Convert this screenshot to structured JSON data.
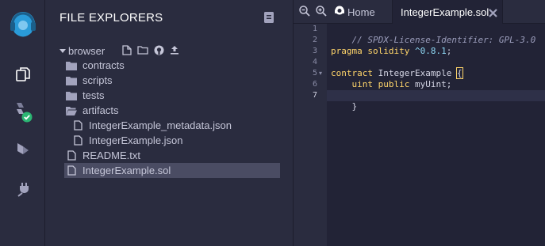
{
  "panel": {
    "title": "FILE EXPLORERS",
    "root": "browser",
    "items": [
      {
        "label": "contracts",
        "type": "folder"
      },
      {
        "label": "scripts",
        "type": "folder"
      },
      {
        "label": "tests",
        "type": "folder"
      },
      {
        "label": "artifacts",
        "type": "folder-open"
      },
      {
        "label": "IntegerExample_metadata.json",
        "type": "file"
      },
      {
        "label": "IntegerExample.json",
        "type": "file"
      },
      {
        "label": "README.txt",
        "type": "file"
      },
      {
        "label": "IntegerExample.sol",
        "type": "file",
        "selected": true
      }
    ]
  },
  "tabs": {
    "home": "Home",
    "active": "IntegerExample.sol"
  },
  "editor": {
    "line_numbers": [
      "1",
      "2",
      "3",
      "4",
      "5",
      "6",
      "7"
    ],
    "active_line": "7",
    "lines": {
      "l1": "// SPDX-License-Identifier: GPL-3.0",
      "l3_kw": "pragma solidity",
      "l3_ver": " ^0.8.1",
      "l3_end": ";",
      "l5_kw": "contract",
      "l5_name": " IntegerExample ",
      "l5_brace": "{",
      "l6_indent": "    ",
      "l6_type": "uint",
      "l6_sp": " ",
      "l6_vis": "public",
      "l6_name": " myUint;",
      "l7": "}"
    }
  },
  "colors": {
    "background": "#222336",
    "panel": "#2a2c3f",
    "accent": "#2a9bd8",
    "success": "#2bb673",
    "keyword": "#ffd56a"
  },
  "icons": {
    "logo": "remix-logo-icon",
    "files": "file-explorer-icon",
    "compile": "solidity-compiler-icon",
    "deploy": "deploy-run-icon",
    "plugin": "plugin-manager-icon"
  }
}
